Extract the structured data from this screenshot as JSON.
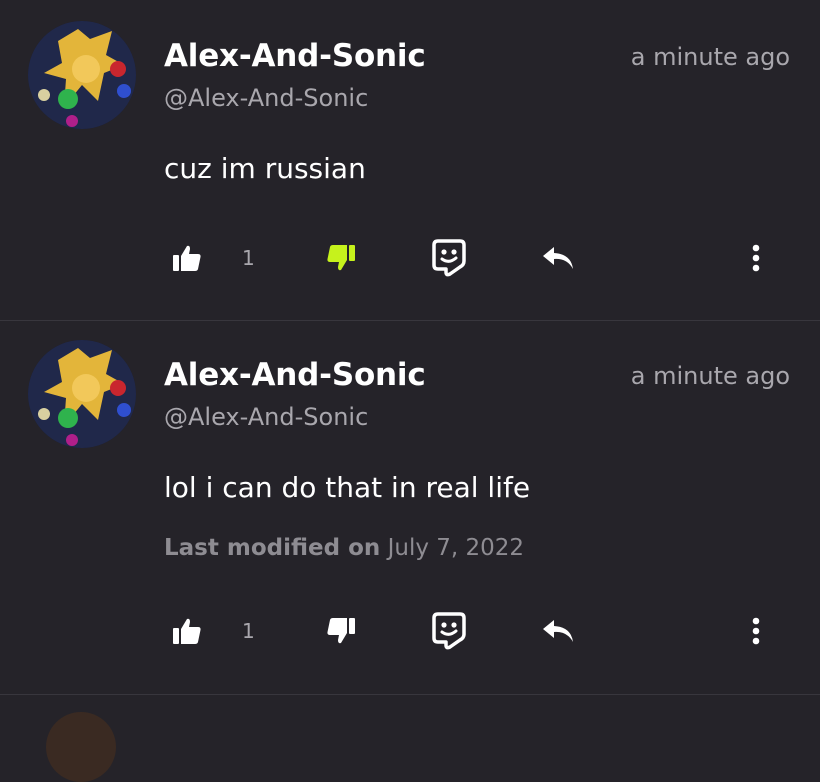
{
  "comments": [
    {
      "author": "Alex-And-Sonic",
      "handle": "@Alex-And-Sonic",
      "time": "a minute ago",
      "text": "cuz im russian",
      "like_count": "1",
      "modified_label": "",
      "modified_date": "",
      "dislike_active": true
    },
    {
      "author": "Alex-And-Sonic",
      "handle": "@Alex-And-Sonic",
      "time": "a minute ago",
      "text": "lol i can do that in real life",
      "like_count": "1",
      "modified_label": "Last modified on",
      "modified_date": "July 7, 2022",
      "dislike_active": false
    }
  ],
  "icons": {
    "like": "thumbs-up-icon",
    "dislike": "thumbs-down-icon",
    "sticker": "sticker-icon",
    "reply": "reply-icon",
    "more": "more-vertical-icon"
  },
  "colors": {
    "background": "#252329",
    "dislike_active": "#c6f21c",
    "icon": "#ffffff",
    "muted_text": "#a9a7ad"
  }
}
